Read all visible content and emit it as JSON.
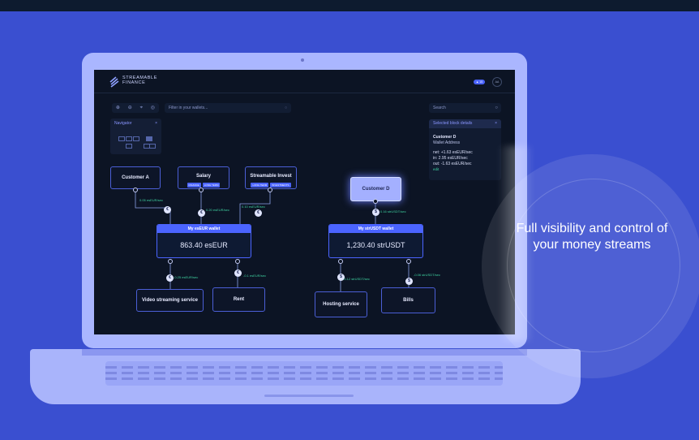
{
  "app": {
    "brand_line1": "STREAMABLE",
    "brand_line2": "FINANCE",
    "pill_label": "▲ 15",
    "avatar_initials": "AA"
  },
  "toolbar": {
    "zoom_icons": [
      "⊕",
      "⊖",
      "⌖",
      "◎"
    ],
    "filter_placeholder": "Filter in your wallets...",
    "search_placeholder": "Search"
  },
  "navigator": {
    "title": "Navigator",
    "close": "×"
  },
  "details_panel": {
    "title": "Selected block details",
    "close": "×",
    "name": "Customer D",
    "subtitle": "Wallet Address",
    "net": "net: +1.63 esEUR/sec",
    "in": "in: 2.95 esEUR/sec",
    "out": "out: -1.63 esEUR/sec",
    "edit": "edit"
  },
  "sources": [
    {
      "label": "Customer A",
      "tags": []
    },
    {
      "label": "Salary",
      "tags": [
        "FINANCE",
        "LONG TERM"
      ]
    },
    {
      "label": "Streamable Invest",
      "tags": [
        "LONG TERM",
        "INVESTMENTS"
      ]
    },
    {
      "label": "Customer D",
      "tags": []
    }
  ],
  "wallets": [
    {
      "title": "My esEUR wallet",
      "balance": "863.40 esEUR"
    },
    {
      "title": "My strUSDT wallet",
      "balance": "1,230.40 strUSDT"
    }
  ],
  "destinations": [
    {
      "label": "Video streaming service"
    },
    {
      "label": "Rent"
    },
    {
      "label": "Hosting service"
    },
    {
      "label": "Bills"
    }
  ],
  "flows": {
    "a": "0.05 esEUR/sec",
    "salary": "0.20 esEUR/sec",
    "invest": "0.10 esEUR/sec",
    "d": "0.16 strUSDT/sec",
    "video": "-0.25 esEUR/sec",
    "rent": "-0.1 esEUR/sec",
    "hosting": "-0.12 strUSDT/sec",
    "bills": "-0.06 strUSDT/sec"
  },
  "badges": [
    "€",
    "€",
    "€",
    "$",
    "€",
    "€",
    "$",
    "$"
  ],
  "tagline": "Full visibility and control of your money streams",
  "colors": {
    "background": "#3a4fd0",
    "laptop": "#aab6ff",
    "screen": "#0c1424",
    "accent": "#4b64ff",
    "flow_text": "#3fd3a1"
  }
}
